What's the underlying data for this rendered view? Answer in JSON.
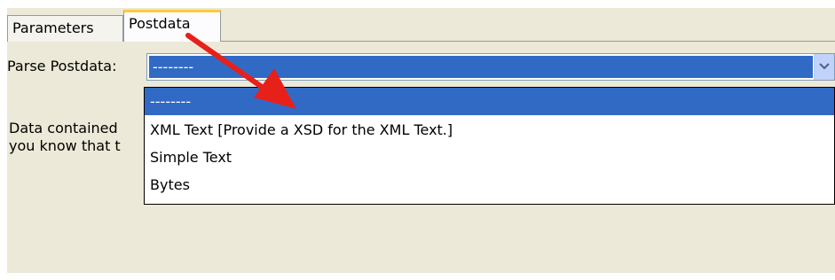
{
  "tabs": [
    {
      "label": "Parameters",
      "active": false
    },
    {
      "label": "Postdata",
      "active": true
    }
  ],
  "parse": {
    "label": "Parse Postdata:",
    "selected": "--------"
  },
  "description": {
    "line1": "Data contained",
    "line2": "you know that t"
  },
  "dropdown": {
    "options": [
      {
        "label": "--------",
        "selected": true
      },
      {
        "label": "XML Text  [Provide a XSD for the XML Text.]",
        "selected": false
      },
      {
        "label": "Simple Text",
        "selected": false
      },
      {
        "label": "Bytes",
        "selected": false
      }
    ]
  },
  "colors": {
    "panel": "#ece9d8",
    "selection": "#316ac5",
    "active_tab_accent": "#ffc83c",
    "annotation_arrow": "#e8201a"
  },
  "icons": {
    "dropdown_button": "chevron-down-icon",
    "annotation": "red-arrow-annotation"
  }
}
